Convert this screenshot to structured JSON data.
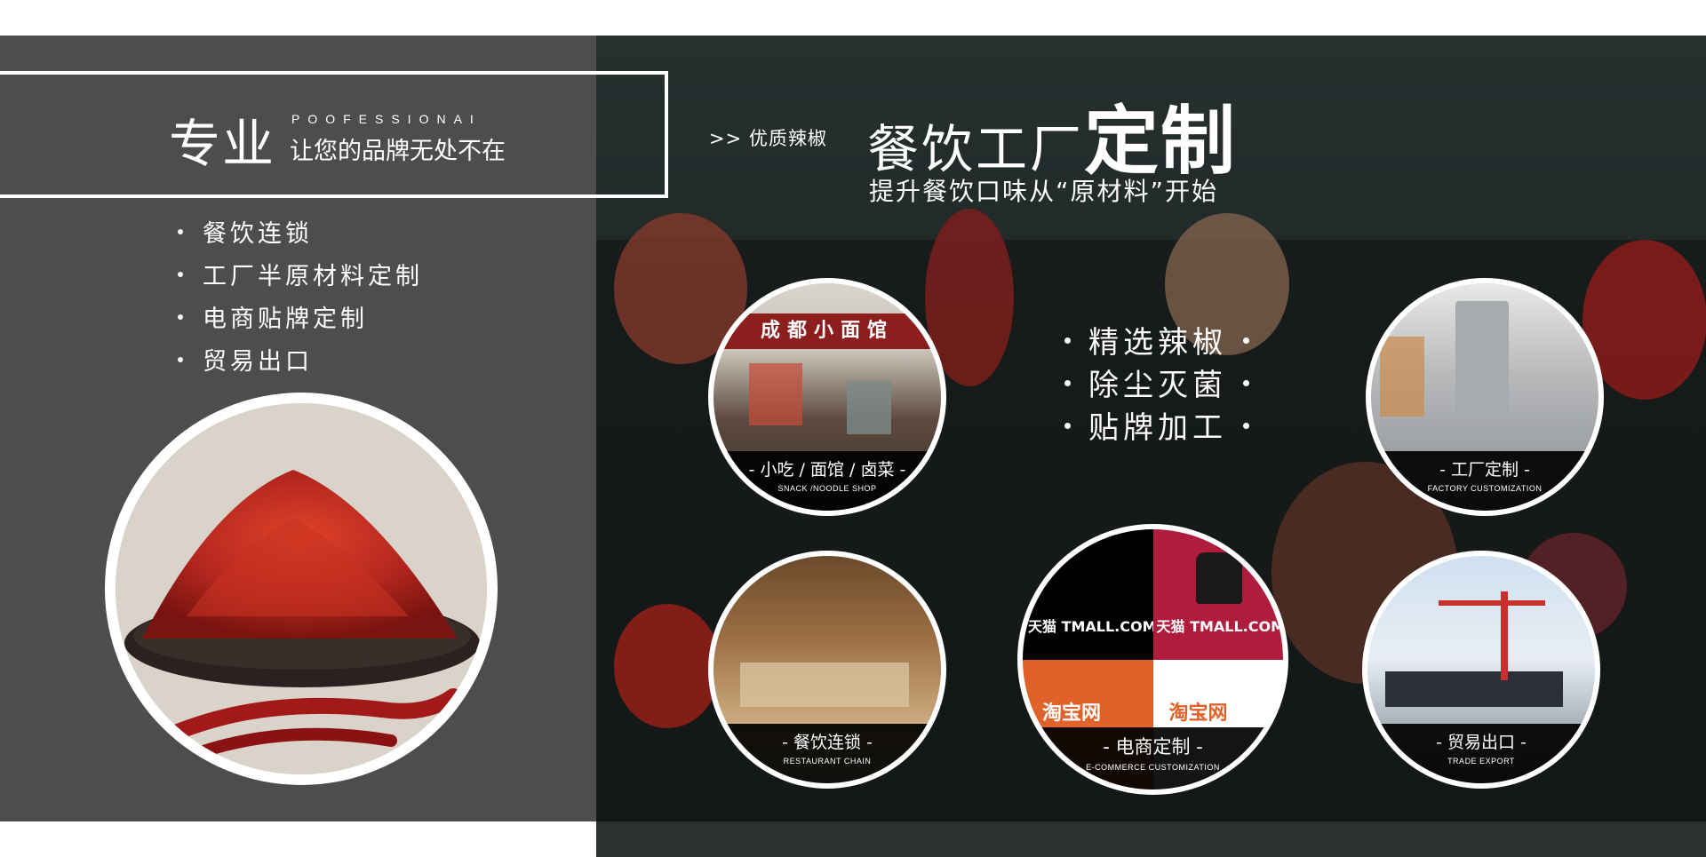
{
  "left": {
    "heading": "专业",
    "heading_en": "POOFESSIONAI",
    "subheading": "让您的品牌无处不在",
    "bullets": [
      "餐饮连锁",
      "工厂半原材料定制",
      "电商贴牌定制",
      "贸易出口"
    ]
  },
  "right": {
    "tag": ">> 优质辣椒",
    "title_part1": "餐饮工厂",
    "title_part2": "定制",
    "subtitle": "提升餐饮口味从“原材料”开始",
    "features": [
      "精选辣椒",
      "除尘灭菌",
      "贴牌加工"
    ]
  },
  "circles": {
    "snack": {
      "sign": "成都小面馆",
      "cn": "- 小吃 / 面馆 / 卤菜 -",
      "en": "SNACK /NOODLE SHOP"
    },
    "factory": {
      "cn": "- 工厂定制 -",
      "en": "FACTORY CUSTOMIZATION"
    },
    "restaurant": {
      "cn": "- 餐饮连锁 -",
      "en": "RESTAURANT CHAIN"
    },
    "ecommerce": {
      "tmall": "天猫 TMALL.COM",
      "taobao": "淘宝网",
      "cn": "- 电商定制 -",
      "en": "E-COMMERCE CUSTOMIZATION"
    },
    "trade": {
      "cn": "- 贸易出口 -",
      "en": "TRADE EXPORT"
    }
  },
  "colors": {
    "left_panel": "#4d4d4f",
    "right_panel": "#1f2726",
    "chili_red": "#b3261e",
    "tmall_red": "#b01c3c",
    "taobao_orange": "#e0622a"
  }
}
